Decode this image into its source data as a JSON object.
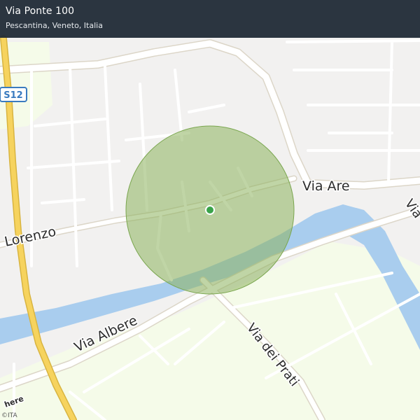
{
  "header": {
    "title": "Via Ponte 100",
    "subtitle": "Pescantina, Veneto, Italia"
  },
  "map": {
    "highway_shield": "S12",
    "streets": {
      "via_are": "Via  Are",
      "lorenzo": "Lorenzo",
      "via_albere": "Via  Albere",
      "via_dei_prati": "Via  dei  Prati",
      "via_edge": "Via"
    },
    "colors": {
      "land": "#f2f1f0",
      "park": "#f5fbe9",
      "water": "#a9cdee",
      "road": "#ffffff",
      "road_casing": "#dcd6c8",
      "highway": "#f6d35e",
      "accuracy_circle": "#8cb35d",
      "location_dot": "#3aa34a"
    }
  },
  "attribution": "©ITA",
  "logo": "here"
}
